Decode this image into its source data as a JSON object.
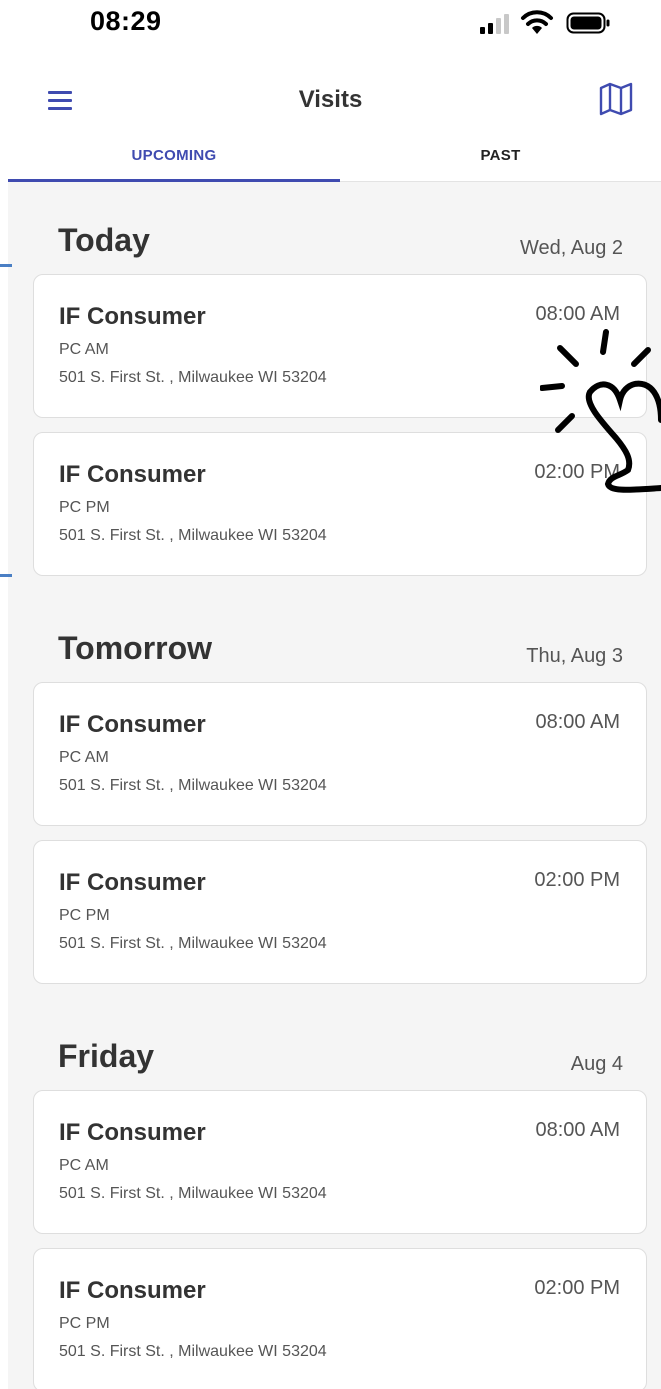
{
  "status_bar": {
    "time": "08:29",
    "icons": [
      "signal-icon",
      "wifi-icon",
      "battery-icon"
    ]
  },
  "header": {
    "title": "Visits",
    "menu_icon": "hamburger-menu-icon",
    "map_icon": "map-icon"
  },
  "tabs": [
    {
      "label": "UPCOMING",
      "active": true
    },
    {
      "label": "PAST",
      "active": false
    }
  ],
  "colors": {
    "accent": "#3f4bb0",
    "background": "#f5f5f5",
    "card": "#ffffff",
    "text": "#333333",
    "secondary_text": "#555555"
  },
  "days": [
    {
      "label": "Today",
      "date": "Wed, Aug 2",
      "visits": [
        {
          "name": "IF Consumer",
          "time": "08:00 AM",
          "type": "PC AM",
          "address": "501 S. First St. , Milwaukee WI 53204"
        },
        {
          "name": "IF Consumer",
          "time": "02:00 PM",
          "type": "PC PM",
          "address": "501 S. First St. , Milwaukee WI 53204"
        }
      ]
    },
    {
      "label": "Tomorrow",
      "date": "Thu, Aug 3",
      "visits": [
        {
          "name": "IF Consumer",
          "time": "08:00 AM",
          "type": "PC AM",
          "address": "501 S. First St. , Milwaukee WI 53204"
        },
        {
          "name": "IF Consumer",
          "time": "02:00 PM",
          "type": "PC PM",
          "address": "501 S. First St. , Milwaukee WI 53204"
        }
      ]
    },
    {
      "label": "Friday",
      "date": "Aug 4",
      "visits": [
        {
          "name": "IF Consumer",
          "time": "08:00 AM",
          "type": "PC AM",
          "address": "501 S. First St. , Milwaukee WI 53204"
        },
        {
          "name": "IF Consumer",
          "time": "02:00 PM",
          "type": "PC PM",
          "address": "501 S. First St. , Milwaukee WI 53204"
        }
      ]
    }
  ]
}
